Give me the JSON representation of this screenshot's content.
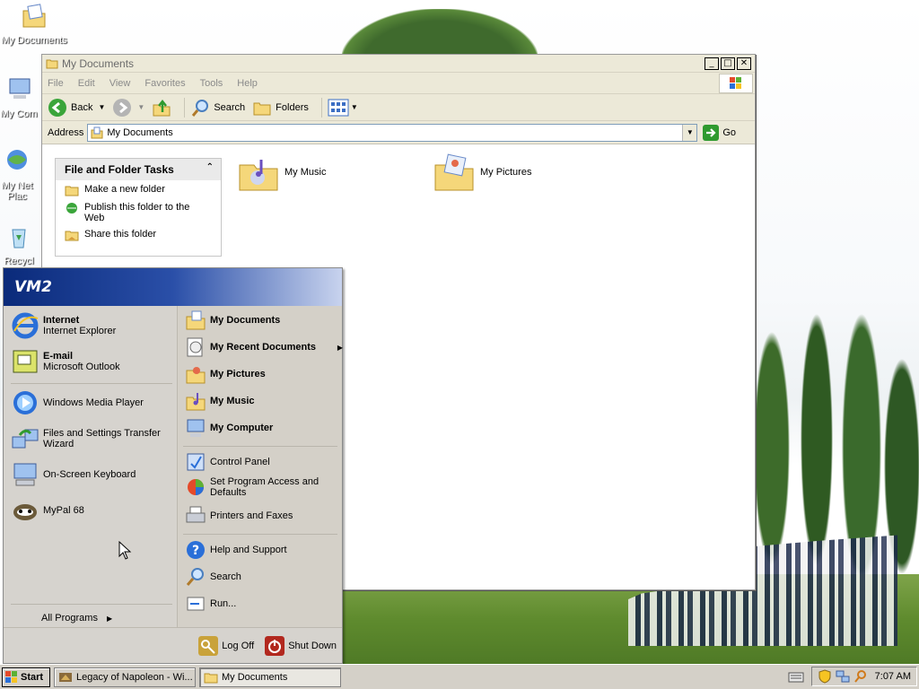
{
  "desktop": {
    "icons": [
      {
        "label": "My Documents",
        "icon": "my-documents-icon"
      },
      {
        "label": "My Com",
        "icon": "my-computer-icon"
      },
      {
        "label": "My Net Plac",
        "icon": "network-places-icon"
      },
      {
        "label": "Recycl",
        "icon": "recycle-bin-icon"
      }
    ]
  },
  "window": {
    "title": "My Documents",
    "menu": [
      "File",
      "Edit",
      "View",
      "Favorites",
      "Tools",
      "Help"
    ],
    "toolbar": {
      "back": "Back",
      "search": "Search",
      "folders": "Folders"
    },
    "address": {
      "label": "Address",
      "value": "My Documents",
      "go": "Go"
    },
    "tasks": {
      "header": "File and Folder Tasks",
      "items": [
        "Make a new folder",
        "Publish this folder to the Web",
        "Share this folder"
      ]
    },
    "folders": [
      "My Music",
      "My Pictures"
    ]
  },
  "start_menu": {
    "user": "VM2",
    "pinned": [
      {
        "name": "Internet",
        "sub": "Internet Explorer",
        "icon": "internet-explorer-icon"
      },
      {
        "name": "E-mail",
        "sub": "Microsoft Outlook",
        "icon": "outlook-icon"
      }
    ],
    "recent": [
      {
        "label": "Windows Media Player",
        "icon": "media-player-icon"
      },
      {
        "label": "Files and Settings Transfer Wizard",
        "icon": "transfer-wizard-icon"
      },
      {
        "label": "On-Screen Keyboard",
        "icon": "keyboard-icon"
      },
      {
        "label": "MyPal 68",
        "icon": "mypal-icon"
      }
    ],
    "all_programs": "All Programs",
    "right_bold": [
      {
        "label": "My Documents",
        "icon": "my-documents-icon"
      },
      {
        "label": "My Recent Documents",
        "icon": "recent-documents-icon"
      },
      {
        "label": "My Pictures",
        "icon": "my-pictures-icon"
      },
      {
        "label": "My Music",
        "icon": "my-music-icon"
      },
      {
        "label": "My Computer",
        "icon": "my-computer-icon"
      }
    ],
    "right_settings": [
      {
        "label": "Control Panel",
        "icon": "control-panel-icon"
      },
      {
        "label": "Set Program Access and Defaults",
        "icon": "program-defaults-icon"
      },
      {
        "label": "Printers and Faxes",
        "icon": "printer-icon"
      }
    ],
    "right_help": [
      {
        "label": "Help and Support",
        "icon": "help-icon"
      },
      {
        "label": "Search",
        "icon": "search-icon"
      },
      {
        "label": "Run...",
        "icon": "run-icon"
      }
    ],
    "log_off": "Log Off",
    "shut_down": "Shut Down"
  },
  "taskbar": {
    "start": "Start",
    "tasks": [
      {
        "label": "Legacy of Napoleon - Wi...",
        "active": false
      },
      {
        "label": "My Documents",
        "active": true
      }
    ],
    "clock": "7:07 AM"
  }
}
